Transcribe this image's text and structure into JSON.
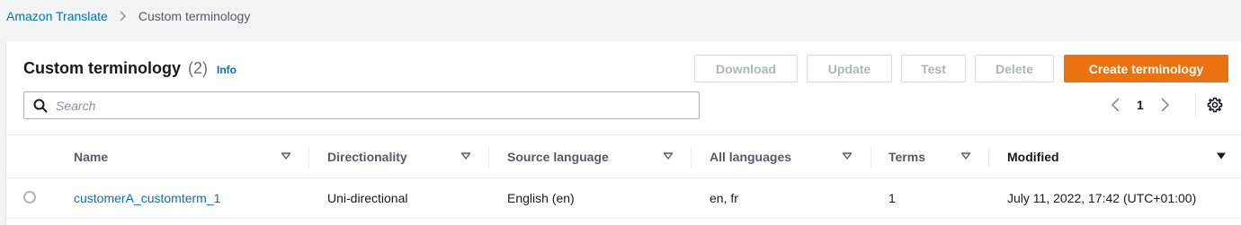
{
  "breadcrumb": {
    "parent": "Amazon Translate",
    "current": "Custom terminology"
  },
  "header": {
    "title": "Custom terminology",
    "count": "(2)",
    "info": "Info"
  },
  "actions": {
    "download": "Download",
    "update": "Update",
    "test": "Test",
    "delete": "Delete",
    "create": "Create terminology"
  },
  "search": {
    "placeholder": "Search",
    "value": ""
  },
  "pagination": {
    "current_page": "1"
  },
  "table": {
    "columns": {
      "name": "Name",
      "directionality": "Directionality",
      "source_language": "Source language",
      "all_languages": "All languages",
      "terms": "Terms",
      "modified": "Modified"
    },
    "rows": [
      {
        "name": "customerA_customterm_1",
        "directionality": "Uni-directional",
        "source_language": "English (en)",
        "all_languages": "en, fr",
        "terms": "1",
        "modified": "July 11, 2022, 17:42 (UTC+01:00)"
      }
    ]
  },
  "colors": {
    "link": "#0073bb",
    "primary": "#ec7211",
    "background": "#f2f3f3"
  },
  "icons": [
    "chevron-right-icon",
    "search-icon",
    "chevron-left-icon",
    "settings-gear-icon",
    "sort-caret-icon",
    "sort-caret-down-icon"
  ]
}
